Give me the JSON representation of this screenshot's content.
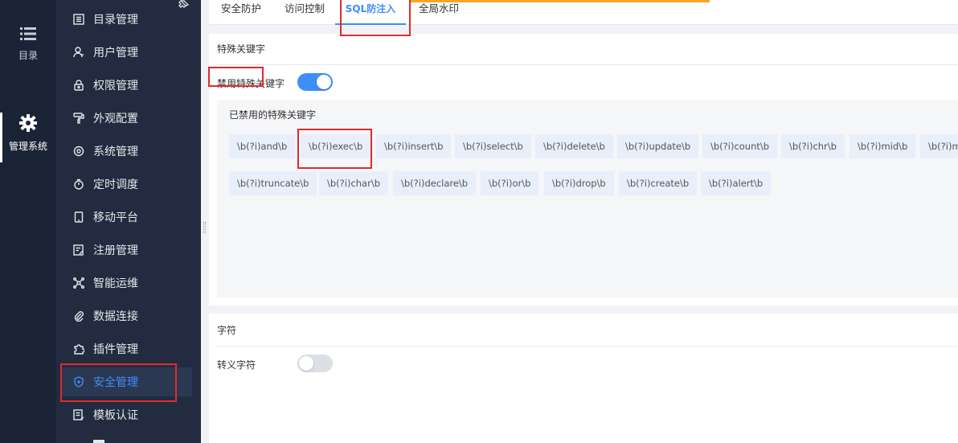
{
  "rail": {
    "items": [
      {
        "label": "目录",
        "icon": "list-icon"
      },
      {
        "label": "管理系统",
        "icon": "gear-icon"
      }
    ]
  },
  "sidebar": {
    "items": [
      {
        "label": "目录管理",
        "icon": "catalog-icon"
      },
      {
        "label": "用户管理",
        "icon": "user-icon"
      },
      {
        "label": "权限管理",
        "icon": "lock-icon"
      },
      {
        "label": "外观配置",
        "icon": "paint-roller-icon"
      },
      {
        "label": "系统管理",
        "icon": "settings-icon"
      },
      {
        "label": "定时调度",
        "icon": "timer-icon"
      },
      {
        "label": "移动平台",
        "icon": "mobile-icon"
      },
      {
        "label": "注册管理",
        "icon": "register-icon"
      },
      {
        "label": "智能运维",
        "icon": "network-icon"
      },
      {
        "label": "数据连接",
        "icon": "paperclip-icon"
      },
      {
        "label": "插件管理",
        "icon": "puzzle-icon"
      },
      {
        "label": "安全管理",
        "icon": "shield-icon",
        "active": true
      },
      {
        "label": "模板认证",
        "icon": "template-icon"
      }
    ]
  },
  "tabs": [
    {
      "label": "安全防护"
    },
    {
      "label": "访问控制"
    },
    {
      "label": "SQL防注入",
      "active": true
    },
    {
      "label": "全局水印"
    }
  ],
  "special_keywords": {
    "section_title": "特殊关键字",
    "toggle_label": "禁用特殊关键字",
    "toggle_on": true,
    "disabled_list_title": "已禁用的特殊关键字",
    "row1": [
      "\\b(?i)and\\b",
      "\\b(?i)exec\\b",
      "\\b(?i)insert\\b",
      "\\b(?i)select\\b",
      "\\b(?i)delete\\b",
      "\\b(?i)update\\b",
      "\\b(?i)count\\b",
      "\\b(?i)chr\\b",
      "\\b(?i)mid\\b",
      "\\b(?i)m"
    ],
    "row2": [
      "\\b(?i)truncate\\b",
      "\\b(?i)char\\b",
      "\\b(?i)declare\\b",
      "\\b(?i)or\\b",
      "\\b(?i)drop\\b",
      "\\b(?i)create\\b",
      "\\b(?i)alert\\b"
    ]
  },
  "characters": {
    "section_title": "字符",
    "toggle_label": "转义字符",
    "toggle_on": false
  },
  "colors": {
    "accent": "#3e8ef7",
    "sidebar_bg": "#222b3f",
    "rail_bg": "#1b2436",
    "highlight_red": "#e02b2b",
    "orange": "#f5a623"
  }
}
